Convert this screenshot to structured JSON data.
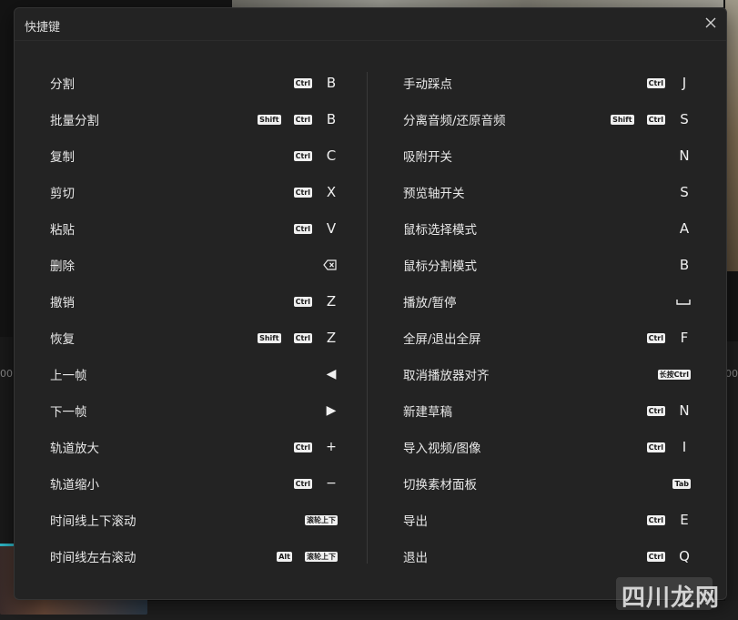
{
  "dialog": {
    "title": "快捷键",
    "close_icon": "close-icon"
  },
  "background": {
    "ruler_left": "00",
    "ruler_right": "00"
  },
  "left": [
    {
      "label": "分割",
      "mods": [
        "Ctrl"
      ],
      "key": "B"
    },
    {
      "label": "批量分割",
      "mods": [
        "Shift",
        "Ctrl"
      ],
      "key": "B"
    },
    {
      "label": "复制",
      "mods": [
        "Ctrl"
      ],
      "key": "C"
    },
    {
      "label": "剪切",
      "mods": [
        "Ctrl"
      ],
      "key": "X"
    },
    {
      "label": "粘贴",
      "mods": [
        "Ctrl"
      ],
      "key": "V"
    },
    {
      "label": "删除",
      "mods": [],
      "key": "",
      "icon": "backspace-icon"
    },
    {
      "label": "撤销",
      "mods": [
        "Ctrl"
      ],
      "key": "Z"
    },
    {
      "label": "恢复",
      "mods": [
        "Shift",
        "Ctrl"
      ],
      "key": "Z"
    },
    {
      "label": "上一帧",
      "mods": [],
      "key": "◀"
    },
    {
      "label": "下一帧",
      "mods": [],
      "key": "▶"
    },
    {
      "label": "轨道放大",
      "mods": [
        "Ctrl"
      ],
      "key": "+"
    },
    {
      "label": "轨道缩小",
      "mods": [
        "Ctrl"
      ],
      "key": "−"
    },
    {
      "label": "时间线上下滚动",
      "mods": [
        "滚轮上下"
      ],
      "key": ""
    },
    {
      "label": "时间线左右滚动",
      "mods": [
        "Alt",
        "滚轮上下"
      ],
      "key": ""
    }
  ],
  "right": [
    {
      "label": "手动踩点",
      "mods": [
        "Ctrl"
      ],
      "key": "J"
    },
    {
      "label": "分离音频/还原音频",
      "mods": [
        "Shift",
        "Ctrl"
      ],
      "key": "S"
    },
    {
      "label": "吸附开关",
      "mods": [],
      "key": "N"
    },
    {
      "label": "预览轴开关",
      "mods": [],
      "key": "S"
    },
    {
      "label": "鼠标选择模式",
      "mods": [],
      "key": "A"
    },
    {
      "label": "鼠标分割模式",
      "mods": [],
      "key": "B"
    },
    {
      "label": "播放/暂停",
      "mods": [],
      "key": "",
      "icon": "space-key-icon"
    },
    {
      "label": "全屏/退出全屏",
      "mods": [
        "Ctrl"
      ],
      "key": "F"
    },
    {
      "label": "取消播放器对齐",
      "mods": [
        "长按Ctrl"
      ],
      "key": ""
    },
    {
      "label": "新建草稿",
      "mods": [
        "Ctrl"
      ],
      "key": "N"
    },
    {
      "label": "导入视频/图像",
      "mods": [
        "Ctrl"
      ],
      "key": "I"
    },
    {
      "label": "切换素材面板",
      "mods": [
        "Tab"
      ],
      "key": ""
    },
    {
      "label": "导出",
      "mods": [
        "Ctrl"
      ],
      "key": "E"
    },
    {
      "label": "退出",
      "mods": [
        "Ctrl"
      ],
      "key": "Q"
    }
  ],
  "watermark": "四川龙网"
}
